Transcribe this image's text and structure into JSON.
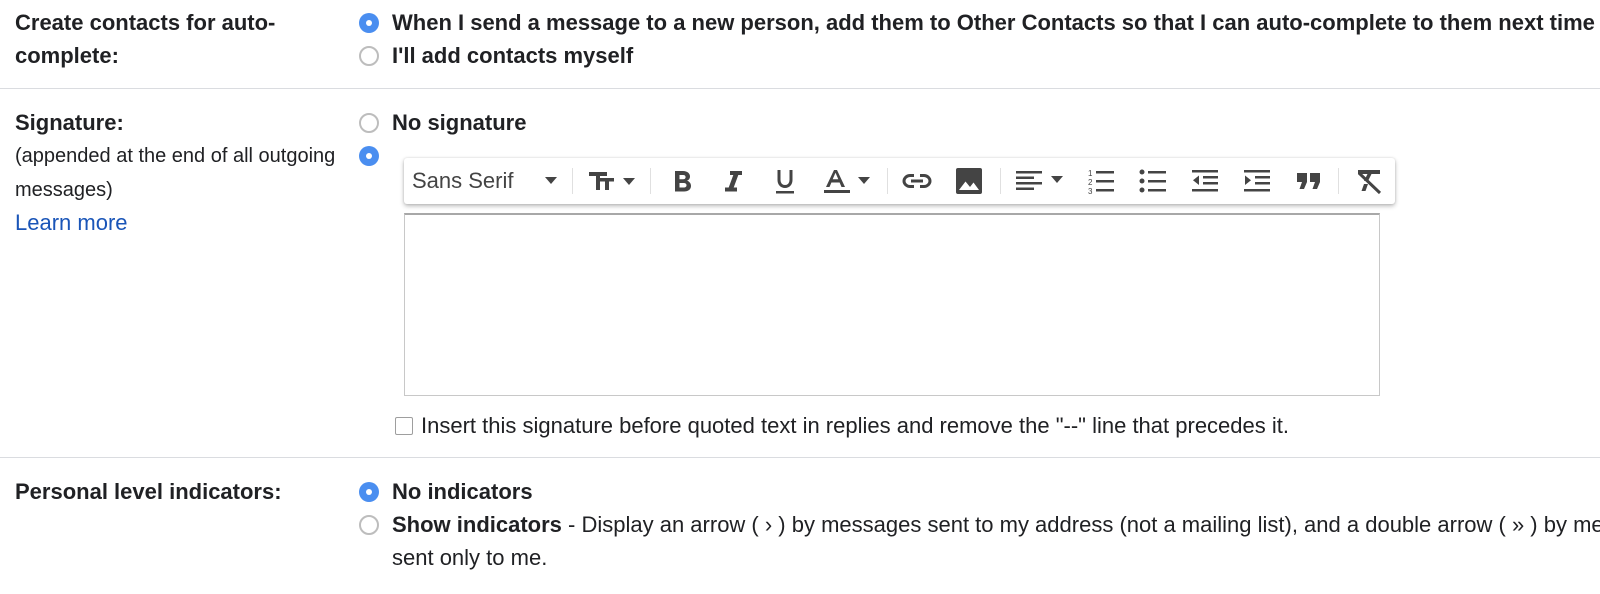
{
  "autocomplete": {
    "label": "Create contacts for auto-complete:",
    "options": [
      {
        "text": "When I send a message to a new person, add them to Other Contacts so that I can auto-complete to them next time",
        "selected": true
      },
      {
        "text": "I'll add contacts myself",
        "selected": false
      }
    ]
  },
  "signature": {
    "label": "Signature:",
    "sublabel": "(appended at the end of all outgoing messages)",
    "learn_more": "Learn more",
    "no_signature": "No signature",
    "custom_selected": true,
    "toolbar": {
      "font": "Sans Serif",
      "buttons": [
        "font-size-icon",
        "bold-icon",
        "italic-icon",
        "underline-icon",
        "text-color-icon",
        "link-icon",
        "image-icon",
        "align-icon",
        "numbered-list-icon",
        "bulleted-list-icon",
        "indent-less-icon",
        "indent-more-icon",
        "quote-icon",
        "remove-formatting-icon"
      ]
    },
    "editor_content": "",
    "insert_before_quoted": "Insert this signature before quoted text in replies and remove the \"--\" line that precedes it.",
    "insert_before_quoted_checked": false
  },
  "indicators": {
    "label": "Personal level indicators:",
    "no_indicators": "No indicators",
    "show_indicators_title": "Show indicators",
    "show_indicators_desc": " - Display an arrow ( › ) by messages sent to my address (not a mailing list), and a double arrow ( » ) by messages",
    "show_indicators_desc2": "sent only to me.",
    "selected": "no_indicators"
  },
  "colors": {
    "accent": "#4a8ef0",
    "link": "#1a55b8",
    "text": "#202124",
    "divider": "#dadce0"
  }
}
